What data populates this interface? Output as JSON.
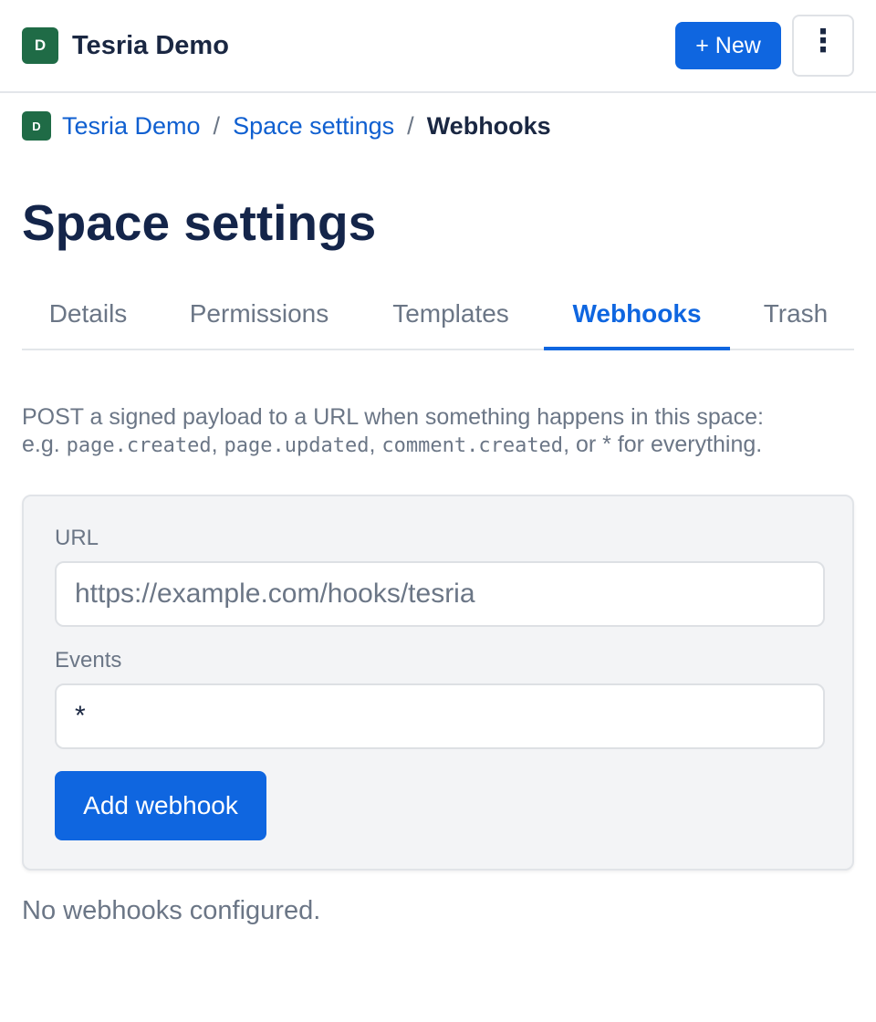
{
  "header": {
    "space_initial": "D",
    "space_name": "Tesria Demo",
    "new_label": "+ New",
    "more_label": "⋮"
  },
  "breadcrumb": {
    "space_initial": "D",
    "items": [
      "Tesria Demo",
      "Space settings",
      "Webhooks"
    ],
    "separator": "/"
  },
  "page": {
    "title": "Space settings"
  },
  "tabs": [
    {
      "label": "Details",
      "active": false
    },
    {
      "label": "Permissions",
      "active": false
    },
    {
      "label": "Templates",
      "active": false
    },
    {
      "label": "Webhooks",
      "active": true
    },
    {
      "label": "Trash",
      "active": false
    }
  ],
  "description": {
    "line1": "POST a signed payload to a URL when something happens in this space:",
    "prefix": "e.g. ",
    "events": [
      "page.created",
      "page.updated",
      "comment.created"
    ],
    "comma": ", ",
    "or_text": ", or ",
    "wildcard": "*",
    "suffix": " for everything."
  },
  "form": {
    "url_label": "URL",
    "url_placeholder": "https://example.com/hooks/tesria",
    "url_value": "",
    "events_label": "Events",
    "events_value": "*",
    "submit_label": "Add webhook"
  },
  "empty_state": "No webhooks configured.",
  "colors": {
    "accent": "#0f66e0",
    "space_badge": "#1f6b46",
    "heading": "#14254a",
    "muted": "#6b7686"
  }
}
